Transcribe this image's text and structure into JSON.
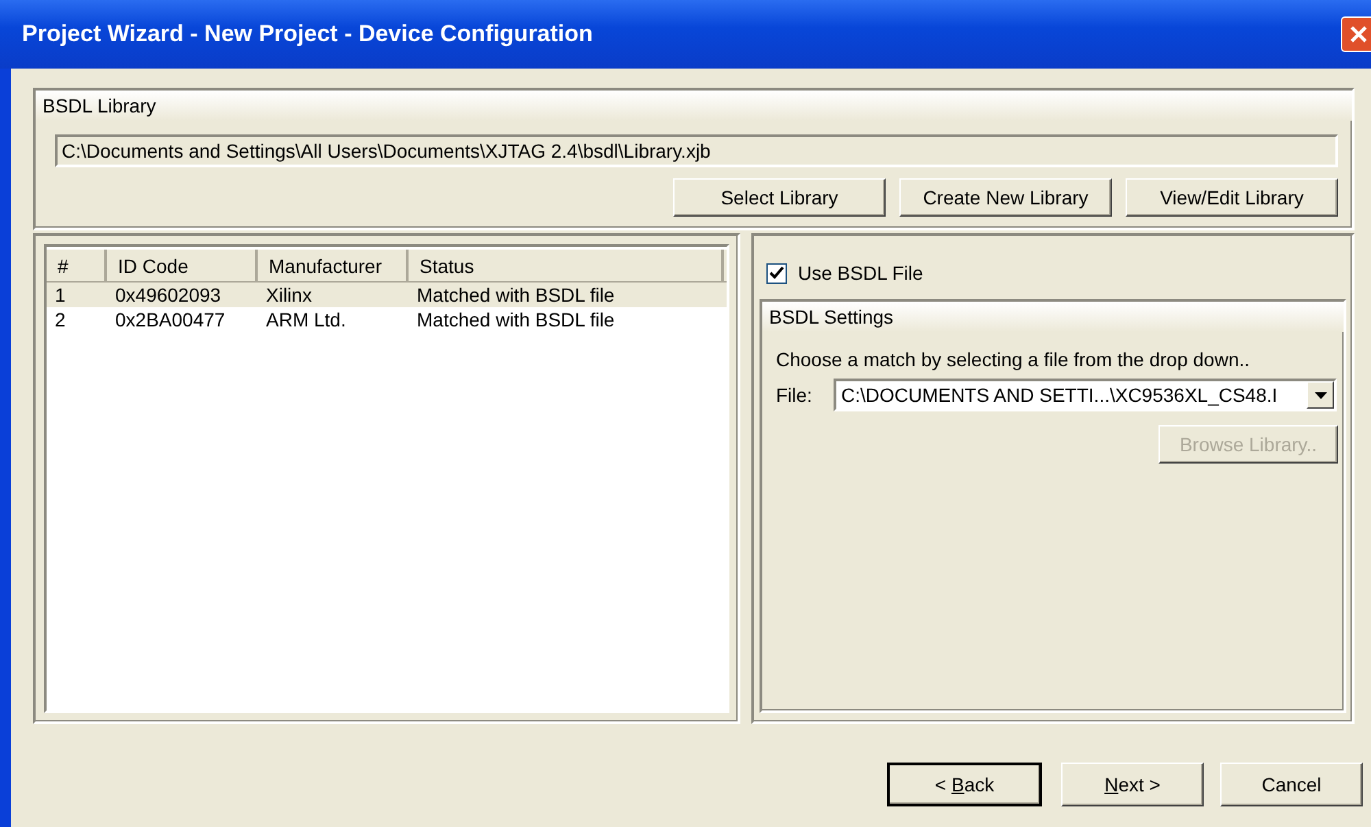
{
  "window": {
    "title": "Project Wizard - New Project - Device Configuration"
  },
  "library": {
    "heading": "BSDL Library",
    "path": "C:\\Documents and Settings\\All Users\\Documents\\XJTAG 2.4\\bsdl\\Library.xjb",
    "buttons": [
      {
        "label": "Select Library",
        "disabled": false
      },
      {
        "label": "Create New Library",
        "disabled": false
      },
      {
        "label": "View/Edit Library",
        "disabled": false
      }
    ]
  },
  "devices": {
    "columns": [
      "#",
      "ID Code",
      "Manufacturer",
      "Status"
    ],
    "rows": [
      {
        "cells": [
          "1",
          "0x49602093",
          "Xilinx",
          "Matched with BSDL file"
        ],
        "selected": true
      },
      {
        "cells": [
          "2",
          "0x2BA00477",
          "ARM Ltd.",
          "Matched with BSDL file"
        ],
        "selected": false
      }
    ]
  },
  "use_bsdl": {
    "label": "Use BSDL File",
    "checked": true
  },
  "settings": {
    "heading": "BSDL Settings",
    "hint": "Choose a match by selecting a file from the drop down..",
    "file_label": "File:",
    "file_value": "C:\\DOCUMENTS AND SETTI...\\XC9536XL_CS48.I",
    "browse": {
      "label": "Browse Library..",
      "disabled": true
    }
  },
  "nav_buttons": [
    {
      "before": "< ",
      "key": "B",
      "after": "ack",
      "default": true
    },
    {
      "key": "N",
      "after": "ext >",
      "default": false
    },
    {
      "before": "Cancel",
      "default": false
    }
  ]
}
